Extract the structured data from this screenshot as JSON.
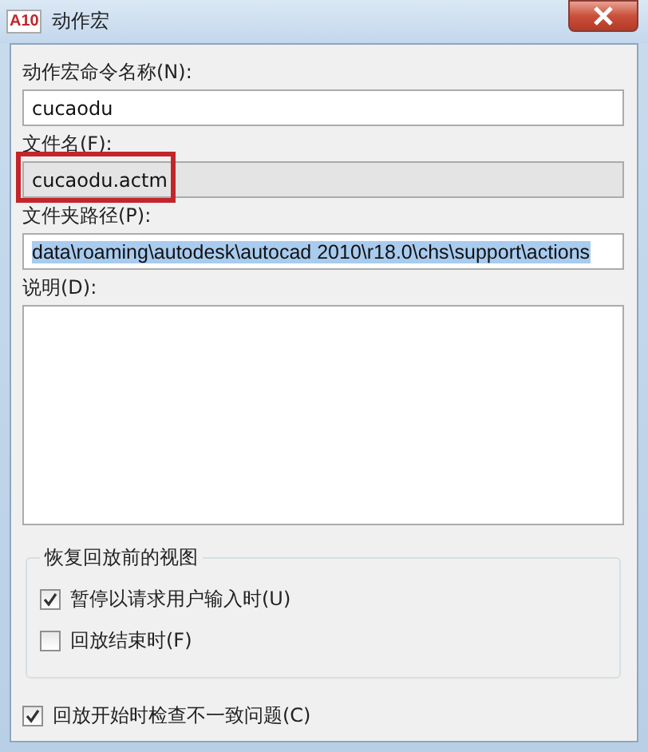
{
  "window": {
    "title": "动作宏",
    "icon_text": "A10"
  },
  "fields": [
    {
      "kind": "input",
      "label": "动作宏命令名称(N):",
      "value": "cucaodu",
      "readonly": false,
      "text_selected": false,
      "highlighted": false
    },
    {
      "kind": "input",
      "label": "文件名(F):",
      "value": "cucaodu.actm",
      "readonly": true,
      "text_selected": false,
      "highlighted": true
    },
    {
      "kind": "input",
      "label": "文件夹路径(P):",
      "value": "data\\roaming\\autodesk\\autocad 2010\\r18.0\\chs\\support\\actions",
      "readonly": false,
      "text_selected": true,
      "highlighted": false
    },
    {
      "kind": "textarea",
      "label": "说明(D):"
    }
  ],
  "group": {
    "title": "恢复回放前的视图",
    "options": [
      {
        "label": "暂停以请求用户输入时(U)",
        "checked": true
      },
      {
        "label": "回放结束时(F)",
        "checked": false
      }
    ]
  },
  "bottom_option": {
    "label": "回放开始时检查不一致问题(C)",
    "checked": true
  }
}
